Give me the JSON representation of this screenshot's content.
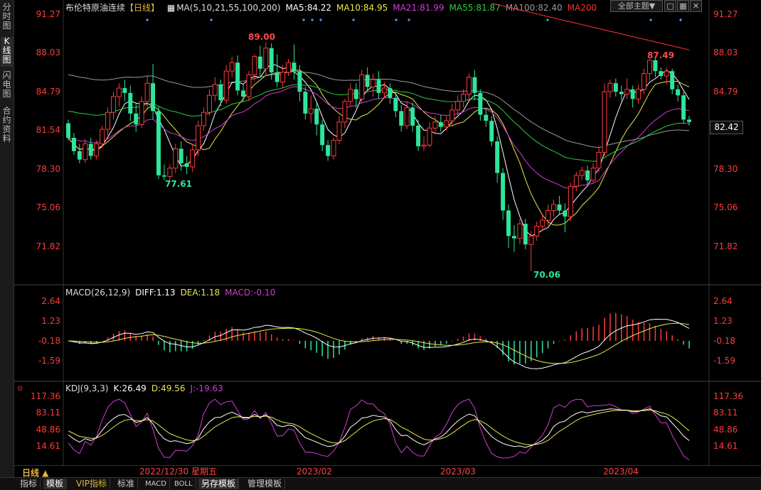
{
  "sidebar": {
    "tabs": [
      {
        "label": "分时图"
      },
      {
        "label": "K线图",
        "active": true
      },
      {
        "label": "闪电图"
      },
      {
        "label": "合约资料"
      }
    ]
  },
  "header": {
    "symbol": "布伦特原油连续",
    "period": "【日线】",
    "ma_label": "MA(5,10,21,55,100,200)",
    "ma5": "MA5:84.22",
    "ma10": "MA10:84.95",
    "ma21": "MA21:81.99",
    "ma55": "MA55:81.87",
    "ma100": "MA100:82.40",
    "ma200": "MA200"
  },
  "top_buttons": {
    "theme": "全部主题▼"
  },
  "price_axis": {
    "labels": [
      "91.27",
      "88.03",
      "84.79",
      "81.54",
      "78.30",
      "75.06",
      "71.82"
    ],
    "current": "82.42"
  },
  "annotations": {
    "high": "89.00",
    "low1": "77.61",
    "low2": "70.06",
    "high2": "87.49"
  },
  "macd": {
    "title": "MACD(26,12,9)",
    "diff": "DIFF:1.13",
    "dea": "DEA:1.18",
    "macd": "MACD:-0.10",
    "labels": [
      "2.64",
      "1.23",
      "-0.18",
      "-1.59"
    ]
  },
  "kdj": {
    "title": "KDJ(9,3,3)",
    "k": "K:26.49",
    "d": "D:49.56",
    "j": "J:-19.63",
    "labels": [
      "117.36",
      "83.11",
      "48.86",
      "14.61"
    ]
  },
  "timeaxis": {
    "period": "日线 ▲",
    "cursor": "2022/12/30 星期五",
    "months": [
      "2023/02",
      "2023/03",
      "2023/04"
    ]
  },
  "bottom_tabs": [
    "指标",
    "模板",
    "VIP指标",
    "标准",
    "MACD",
    "BOLL",
    "另存模板",
    "管理模板"
  ],
  "colors": {
    "up": "#ff3b3b",
    "down": "#2ee59d",
    "ma5": "#ffffff",
    "ma10": "#e8e84a",
    "ma21": "#d23cd2",
    "ma55": "#2ecc40",
    "ma100": "#9a9a9a",
    "ma200": "#ff3030"
  },
  "chart_data": {
    "type": "candlestick",
    "ylim": [
      69.5,
      92
    ],
    "candles": [
      [
        82.3,
        81.1,
        82.6,
        80.9
      ],
      [
        81.1,
        80.0,
        81.5,
        79.7
      ],
      [
        80.0,
        79.3,
        80.6,
        79.0
      ],
      [
        79.3,
        80.6,
        81.0,
        79.0
      ],
      [
        80.6,
        79.6,
        81.1,
        79.3
      ],
      [
        79.6,
        80.6,
        80.9,
        79.3
      ],
      [
        80.6,
        81.8,
        82.1,
        80.3
      ],
      [
        81.8,
        83.2,
        83.6,
        81.3
      ],
      [
        83.2,
        84.5,
        84.9,
        82.6
      ],
      [
        84.5,
        85.2,
        85.6,
        83.7
      ],
      [
        85.2,
        84.8,
        85.9,
        84.1
      ],
      [
        84.8,
        83.1,
        85.4,
        82.5
      ],
      [
        83.1,
        82.2,
        83.9,
        81.6
      ],
      [
        82.2,
        84.1,
        84.5,
        81.9
      ],
      [
        84.1,
        85.6,
        86.2,
        83.6
      ],
      [
        85.6,
        83.3,
        87.2,
        82.6
      ],
      [
        83.3,
        78.0,
        83.7,
        77.7
      ],
      [
        78.0,
        77.9,
        78.9,
        77.6
      ],
      [
        77.9,
        78.6,
        78.9,
        77.5
      ],
      [
        78.6,
        80.2,
        80.6,
        78.2
      ],
      [
        80.2,
        79.0,
        80.8,
        78.4
      ],
      [
        79.0,
        78.7,
        79.6,
        78.1
      ],
      [
        78.7,
        80.1,
        80.6,
        78.3
      ],
      [
        80.1,
        82.1,
        82.5,
        79.6
      ],
      [
        82.1,
        83.2,
        83.6,
        81.7
      ],
      [
        83.2,
        84.6,
        85.1,
        82.9
      ],
      [
        84.6,
        85.5,
        86.1,
        84.1
      ],
      [
        85.5,
        84.2,
        85.9,
        83.7
      ],
      [
        84.2,
        86.6,
        87.1,
        83.9
      ],
      [
        86.6,
        87.3,
        87.8,
        86.1
      ],
      [
        87.3,
        85.0,
        87.9,
        84.6
      ],
      [
        85.0,
        84.5,
        85.6,
        84.1
      ],
      [
        84.5,
        86.3,
        86.6,
        84.1
      ],
      [
        86.3,
        87.8,
        88.0,
        85.8
      ],
      [
        87.8,
        86.8,
        88.7,
        86.1
      ],
      [
        86.8,
        88.5,
        89.0,
        86.3
      ],
      [
        88.5,
        86.5,
        88.9,
        85.9
      ],
      [
        86.5,
        85.7,
        88.0,
        85.3
      ],
      [
        85.7,
        86.5,
        87.1,
        85.2
      ],
      [
        86.5,
        87.3,
        87.6,
        86.2
      ],
      [
        87.3,
        86.6,
        88.8,
        85.9
      ],
      [
        86.6,
        84.9,
        87.1,
        84.1
      ],
      [
        84.9,
        83.1,
        85.3,
        82.6
      ],
      [
        83.1,
        83.5,
        84.6,
        82.3
      ],
      [
        83.5,
        82.2,
        84.0,
        81.3
      ],
      [
        82.2,
        80.5,
        82.6,
        80.0
      ],
      [
        80.5,
        79.6,
        80.9,
        79.2
      ],
      [
        79.6,
        80.9,
        81.1,
        79.3
      ],
      [
        80.9,
        82.4,
        82.9,
        80.6
      ],
      [
        82.4,
        84.1,
        84.3,
        81.9
      ],
      [
        84.1,
        85.1,
        85.6,
        83.7
      ],
      [
        85.1,
        84.3,
        85.6,
        83.6
      ],
      [
        84.3,
        86.3,
        86.7,
        84.0
      ],
      [
        86.3,
        85.3,
        86.9,
        84.9
      ],
      [
        85.3,
        85.9,
        86.4,
        84.5
      ],
      [
        85.9,
        84.8,
        86.6,
        84.3
      ],
      [
        84.8,
        85.2,
        85.7,
        84.4
      ],
      [
        85.2,
        84.4,
        85.6,
        83.9
      ],
      [
        84.4,
        83.3,
        84.9,
        82.8
      ],
      [
        83.3,
        82.1,
        83.8,
        81.6
      ],
      [
        82.1,
        83.6,
        84.1,
        81.8
      ],
      [
        83.6,
        82.1,
        84.0,
        81.6
      ],
      [
        82.1,
        80.4,
        82.6,
        80.0
      ],
      [
        80.4,
        80.5,
        81.2,
        80.0
      ],
      [
        80.5,
        81.9,
        82.4,
        80.3
      ],
      [
        81.9,
        82.4,
        82.9,
        81.4
      ],
      [
        82.4,
        82.0,
        83.0,
        81.6
      ],
      [
        82.0,
        82.5,
        82.9,
        81.7
      ],
      [
        82.5,
        83.4,
        83.9,
        82.1
      ],
      [
        83.4,
        84.1,
        84.6,
        83.0
      ],
      [
        84.1,
        84.7,
        85.1,
        83.6
      ],
      [
        84.7,
        86.1,
        86.4,
        84.3
      ],
      [
        86.1,
        84.8,
        86.7,
        84.2
      ],
      [
        84.8,
        83.0,
        85.1,
        82.5
      ],
      [
        83.0,
        82.5,
        83.4,
        82.0
      ],
      [
        82.5,
        80.8,
        82.9,
        80.4
      ],
      [
        80.8,
        78.2,
        81.2,
        77.4
      ],
      [
        78.2,
        75.1,
        78.6,
        74.3
      ],
      [
        75.1,
        73.0,
        75.6,
        72.0
      ],
      [
        73.0,
        72.8,
        73.9,
        71.7
      ],
      [
        72.8,
        74.0,
        74.4,
        72.3
      ],
      [
        74.0,
        72.3,
        74.4,
        71.9
      ],
      [
        72.3,
        73.0,
        73.4,
        70.1
      ],
      [
        73.0,
        73.8,
        74.2,
        72.6
      ],
      [
        73.8,
        74.3,
        74.8,
        73.4
      ],
      [
        74.3,
        75.1,
        75.6,
        73.9
      ],
      [
        75.1,
        75.6,
        76.0,
        74.6
      ],
      [
        75.6,
        75.1,
        76.3,
        74.8
      ],
      [
        75.1,
        74.6,
        75.7,
        73.3
      ],
      [
        74.6,
        77.1,
        77.4,
        74.2
      ],
      [
        77.1,
        78.0,
        78.3,
        76.7
      ],
      [
        78.0,
        78.4,
        78.7,
        77.6
      ],
      [
        78.4,
        77.6,
        78.8,
        77.2
      ],
      [
        77.6,
        78.6,
        79.0,
        77.4
      ],
      [
        78.6,
        79.9,
        80.4,
        78.3
      ],
      [
        79.9,
        84.9,
        85.6,
        79.6
      ],
      [
        84.9,
        85.6,
        85.9,
        84.4
      ],
      [
        85.6,
        84.9,
        86.0,
        84.5
      ],
      [
        84.9,
        84.7,
        85.4,
        84.2
      ],
      [
        84.7,
        85.1,
        86.0,
        84.3
      ],
      [
        85.1,
        84.3,
        85.4,
        83.6
      ],
      [
        84.3,
        85.1,
        85.5,
        83.9
      ],
      [
        85.1,
        86.4,
        86.8,
        84.7
      ],
      [
        86.4,
        87.5,
        87.6,
        85.8
      ],
      [
        87.5,
        86.6,
        87.8,
        86.1
      ],
      [
        86.6,
        86.2,
        86.9,
        85.9
      ],
      [
        86.2,
        86.6,
        86.9,
        85.5
      ],
      [
        86.6,
        85.1,
        86.8,
        84.7
      ],
      [
        85.1,
        84.6,
        85.5,
        84.1
      ],
      [
        84.6,
        82.6,
        84.9,
        82.3
      ],
      [
        82.6,
        82.4,
        82.9,
        82.1
      ]
    ]
  }
}
